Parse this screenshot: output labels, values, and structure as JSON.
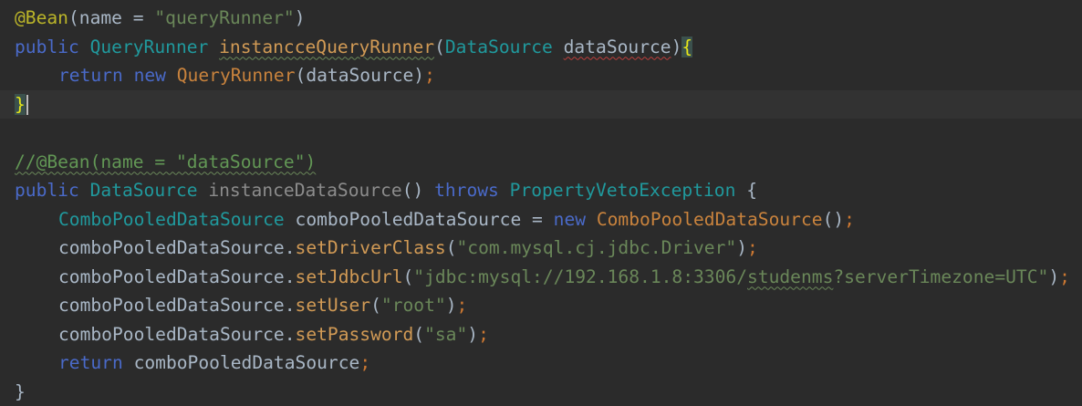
{
  "editor": {
    "lines": [
      {
        "tokens": [
          {
            "t": "@Bean",
            "c": "tok-annotation"
          },
          {
            "t": "(",
            "c": "tok-plain"
          },
          {
            "t": "name = ",
            "c": "tok-plain"
          },
          {
            "t": "\"queryRunner\"",
            "c": "tok-string"
          },
          {
            "t": ")",
            "c": "tok-plain"
          }
        ]
      },
      {
        "tokens": [
          {
            "t": "public ",
            "c": "tok-kw-blue"
          },
          {
            "t": "QueryRunner ",
            "c": "tok-type"
          },
          {
            "t": "instancceQueryRunner",
            "c": "tok-method-gold squiggle-green"
          },
          {
            "t": "(",
            "c": "tok-plain"
          },
          {
            "t": "DataSource ",
            "c": "tok-type"
          },
          {
            "t": "dataSource",
            "c": "tok-param squiggle-red"
          },
          {
            "t": ")",
            "c": "tok-plain"
          },
          {
            "t": "{",
            "c": "tok-brace-hl"
          }
        ]
      },
      {
        "indent": 1,
        "tokens": [
          {
            "t": "return ",
            "c": "tok-kw-blue"
          },
          {
            "t": "new ",
            "c": "tok-kw-blue"
          },
          {
            "t": "QueryRunner",
            "c": "tok-type-gold"
          },
          {
            "t": "(dataSource)",
            "c": "tok-plain"
          },
          {
            "t": ";",
            "c": "tok-semi"
          }
        ]
      },
      {
        "current": true,
        "caret": true,
        "tokens": [
          {
            "t": "}",
            "c": "tok-brace-hl-2"
          }
        ]
      },
      {
        "tokens": []
      },
      {
        "tokens": [
          {
            "t": "//@Bean(name = \"dataSource\")",
            "c": "tok-comment squiggle-green"
          }
        ]
      },
      {
        "tokens": [
          {
            "t": "public ",
            "c": "tok-kw-blue"
          },
          {
            "t": "DataSource ",
            "c": "tok-type"
          },
          {
            "t": "instanceDataSource",
            "c": "tok-method-gray"
          },
          {
            "t": "() ",
            "c": "tok-plain"
          },
          {
            "t": "throws ",
            "c": "tok-kw-blue"
          },
          {
            "t": "PropertyVetoException ",
            "c": "tok-type"
          },
          {
            "t": "{",
            "c": "tok-plain"
          }
        ]
      },
      {
        "indent": 1,
        "tokens": [
          {
            "t": "ComboPooledDataSource ",
            "c": "tok-type"
          },
          {
            "t": "comboPooledDataSource = ",
            "c": "tok-plain"
          },
          {
            "t": "new ",
            "c": "tok-kw-blue"
          },
          {
            "t": "ComboPooledDataSource",
            "c": "tok-type-gold"
          },
          {
            "t": "()",
            "c": "tok-plain"
          },
          {
            "t": ";",
            "c": "tok-semi"
          }
        ]
      },
      {
        "indent": 1,
        "tokens": [
          {
            "t": "comboPooledDataSource.",
            "c": "tok-plain"
          },
          {
            "t": "setDriverClass",
            "c": "tok-method-gold"
          },
          {
            "t": "(",
            "c": "tok-plain"
          },
          {
            "t": "\"com.mysql.cj.jdbc.Driver\"",
            "c": "tok-string"
          },
          {
            "t": ")",
            "c": "tok-plain"
          },
          {
            "t": ";",
            "c": "tok-semi"
          }
        ]
      },
      {
        "indent": 1,
        "tokens": [
          {
            "t": "comboPooledDataSource.",
            "c": "tok-plain"
          },
          {
            "t": "setJdbcUrl",
            "c": "tok-method-gold"
          },
          {
            "t": "(",
            "c": "tok-plain"
          },
          {
            "t": "\"jdbc:mysql://192.168.1.8:3306/",
            "c": "tok-string"
          },
          {
            "t": "studenms",
            "c": "tok-string squiggle-green"
          },
          {
            "t": "?serverTimezone=UTC\"",
            "c": "tok-string"
          },
          {
            "t": ")",
            "c": "tok-plain"
          },
          {
            "t": ";",
            "c": "tok-semi"
          }
        ]
      },
      {
        "indent": 1,
        "tokens": [
          {
            "t": "comboPooledDataSource.",
            "c": "tok-plain"
          },
          {
            "t": "setUser",
            "c": "tok-method-gold"
          },
          {
            "t": "(",
            "c": "tok-plain"
          },
          {
            "t": "\"root\"",
            "c": "tok-string"
          },
          {
            "t": ")",
            "c": "tok-plain"
          },
          {
            "t": ";",
            "c": "tok-semi"
          }
        ]
      },
      {
        "indent": 1,
        "tokens": [
          {
            "t": "comboPooledDataSource.",
            "c": "tok-plain"
          },
          {
            "t": "setPassword",
            "c": "tok-method-gold"
          },
          {
            "t": "(",
            "c": "tok-plain"
          },
          {
            "t": "\"sa\"",
            "c": "tok-string"
          },
          {
            "t": ")",
            "c": "tok-plain"
          },
          {
            "t": ";",
            "c": "tok-semi"
          }
        ]
      },
      {
        "indent": 1,
        "tokens": [
          {
            "t": "return ",
            "c": "tok-kw-blue"
          },
          {
            "t": "comboPooledDataSource",
            "c": "tok-plain"
          },
          {
            "t": ";",
            "c": "tok-semi"
          }
        ]
      },
      {
        "tokens": [
          {
            "t": "}",
            "c": "tok-plain"
          }
        ]
      }
    ]
  },
  "colors": {
    "background": "#2b2b2b",
    "current_line": "#323232",
    "annotation": "#bbb529",
    "keyword": "#4a6ac9",
    "type": "#20999d",
    "string": "#6a8759",
    "method": "#d19a55",
    "semicolon": "#cc7832",
    "plain": "#a9b7c6",
    "brace_match": "#e6e619"
  }
}
